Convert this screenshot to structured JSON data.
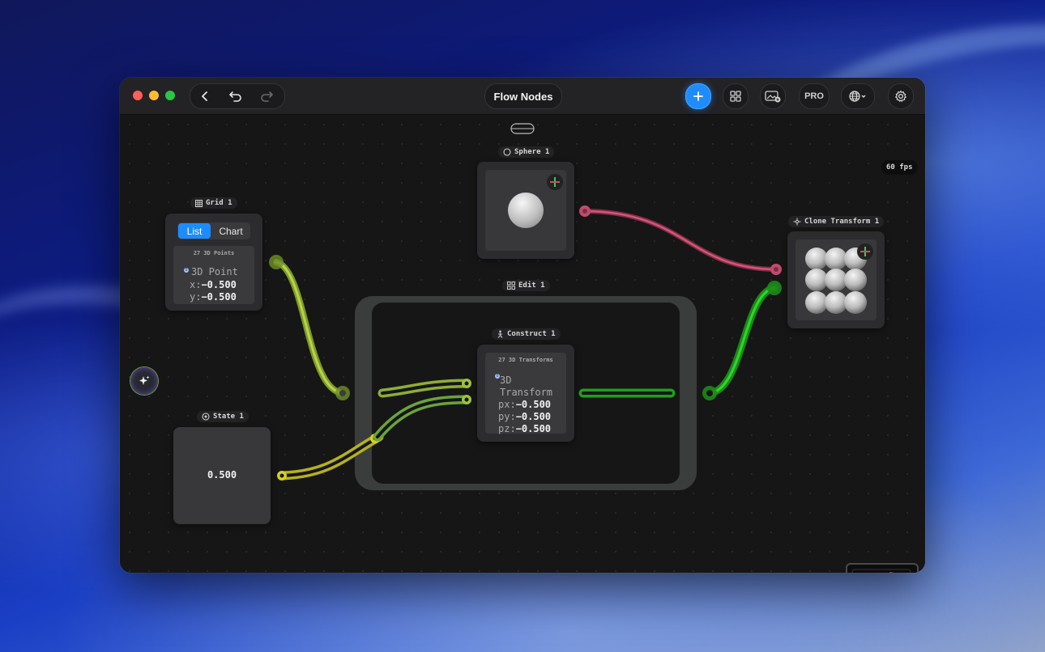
{
  "window": {
    "title": "Flow Nodes",
    "fps_label": "60 fps",
    "pro_label": "PRO"
  },
  "toolbar": {
    "back_icon": "chevron-left-icon",
    "undo_icon": "undo-icon",
    "redo_icon": "redo-icon",
    "add_icon": "plus-icon",
    "grid_icon": "grid-icon",
    "media_icon": "photo-add-icon",
    "globe_icon": "globe-icon",
    "settings_icon": "gear-icon"
  },
  "nodes": {
    "grid": {
      "label": "Grid 1",
      "tab_list": "List",
      "tab_chart": "Chart",
      "selected_tab": "List",
      "count_label": "27 3D Points",
      "badge": "0",
      "item_type": "3D Point",
      "x_key": "x:",
      "x_value": "−0.500",
      "y_key": "y:",
      "y_value": "−0.500"
    },
    "sphere": {
      "label": "Sphere 1"
    },
    "clone": {
      "label": "Clone Transform 1"
    },
    "edit": {
      "label": "Edit 1"
    },
    "construct": {
      "label": "Construct 1",
      "count_label": "27 3D Transforms",
      "badge": "0",
      "item_type_1": "3D",
      "item_type_2": "Transform",
      "px_key": "px:",
      "px_value": "−0.500",
      "py_key": "py:",
      "py_value": "−0.500",
      "pz_key": "pz:",
      "pz_value": "−0.500"
    },
    "state": {
      "label": "State 1",
      "value": "0.500"
    }
  },
  "colors": {
    "accent": "#1e8cff",
    "wire_yellow_green": "#a8c83a",
    "wire_yellow": "#d7d020",
    "wire_green": "#22c41e",
    "wire_pink": "#d8527a"
  }
}
